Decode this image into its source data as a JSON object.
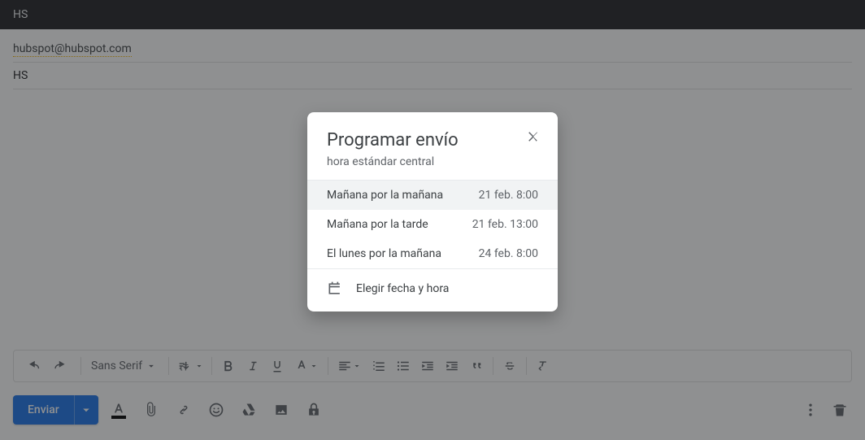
{
  "window": {
    "title": "HS"
  },
  "compose": {
    "to_chip": "hubspot@hubspot.com",
    "subject": "HS",
    "font_name": "Sans Serif",
    "send_label": "Enviar"
  },
  "modal": {
    "title": "Programar envío",
    "subtitle": "hora estándar central",
    "options": [
      {
        "label": "Mañana por la mañana",
        "time": "21 feb. 8:00"
      },
      {
        "label": "Mañana por la tarde",
        "time": "21 feb. 13:00"
      },
      {
        "label": "El lunes por la mañana",
        "time": "24 feb. 8:00"
      }
    ],
    "custom_label": "Elegir fecha y hora"
  }
}
